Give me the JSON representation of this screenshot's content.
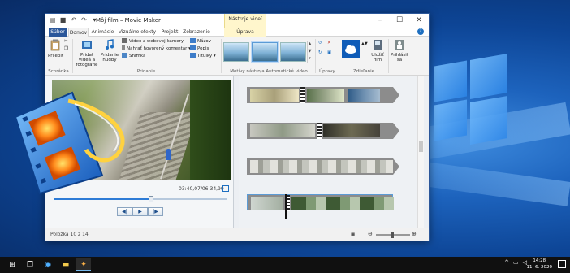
{
  "window": {
    "title": "Môj film – Movie Maker",
    "contextual_group": "Nástroje videí"
  },
  "tabs": [
    "Súbor",
    "Domov",
    "Animácie",
    "Vizuálne efekty",
    "Projekt",
    "Zobrazenie",
    "Úprava"
  ],
  "ribbon": {
    "paste_label": "Prilepiť",
    "add_videos_label": "Pridať videá a fotografie",
    "add_music_label": "Pridanie hudby",
    "webcam_label": "Video z webovej kamery",
    "narration_label": "Nahrať hovorený komentár",
    "snapshot_label": "Snímka",
    "title_label": "Názov",
    "caption_label": "Popis",
    "credits_label": "Titulky",
    "save_movie_label": "Uložiť film",
    "sign_in_label": "Prihlásiť sa",
    "groups": {
      "clipboard": "Schránka",
      "add": "Pridanie",
      "automovie": "Motívy nástroja Automatické video",
      "editing": "Úpravy",
      "sharing": "Zdieľanie"
    }
  },
  "preview": {
    "timecode": "03:40,07/06:34,90",
    "progress": 0.56
  },
  "status": {
    "item_count": "Položka 10 z 14",
    "zoom_level": 0.48
  },
  "taskbar": {
    "time": "14:28",
    "date": "11. 6. 2020"
  },
  "colors": {
    "accent": "#2b579a",
    "contextual": "#fff6cc",
    "taskbar": "#101010"
  }
}
